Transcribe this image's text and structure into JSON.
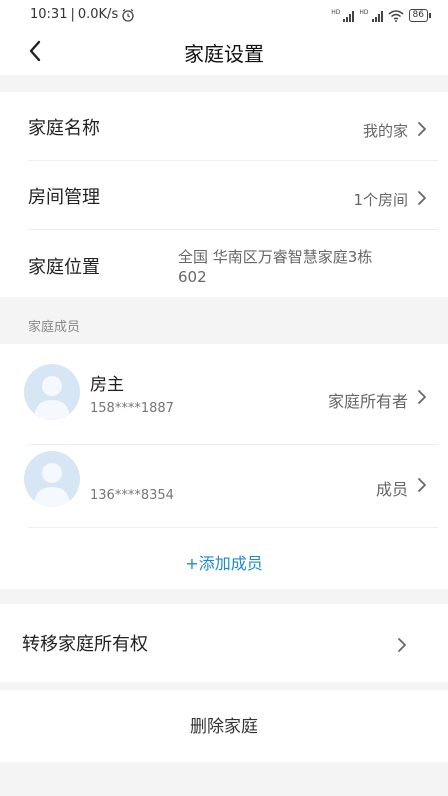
{
  "status_bar": {
    "time": "10:31",
    "separator": "|",
    "speed": "0.0K/s",
    "battery": "86",
    "icons": [
      "alarm-icon",
      "signal-icon",
      "wifi-icon",
      "battery-icon"
    ]
  },
  "header": {
    "title": "家庭设置",
    "back_icon": "chevron-left-icon"
  },
  "settings": {
    "name_label": "家庭名称",
    "name_value": "我的家",
    "rooms_label": "房间管理",
    "rooms_value": "1个房间",
    "location_label": "家庭位置",
    "location_value_line1": "全国 华南区万睿智慧家庭3栋",
    "location_value_line2": "602"
  },
  "members": {
    "section_label": "家庭成员",
    "items": [
      {
        "name": "房主",
        "phone": "158****1887",
        "role": "家庭所有者"
      },
      {
        "name": "",
        "phone": "136****8354",
        "role": "成员"
      }
    ],
    "add_label": "+添加成员"
  },
  "transfer": {
    "label": "转移家庭所有权"
  },
  "delete": {
    "label": "删除家庭"
  },
  "colors": {
    "accent": "#1d8bd2",
    "avatar_bg": "#d7e6f4",
    "page_bg": "#f4f4f4"
  }
}
